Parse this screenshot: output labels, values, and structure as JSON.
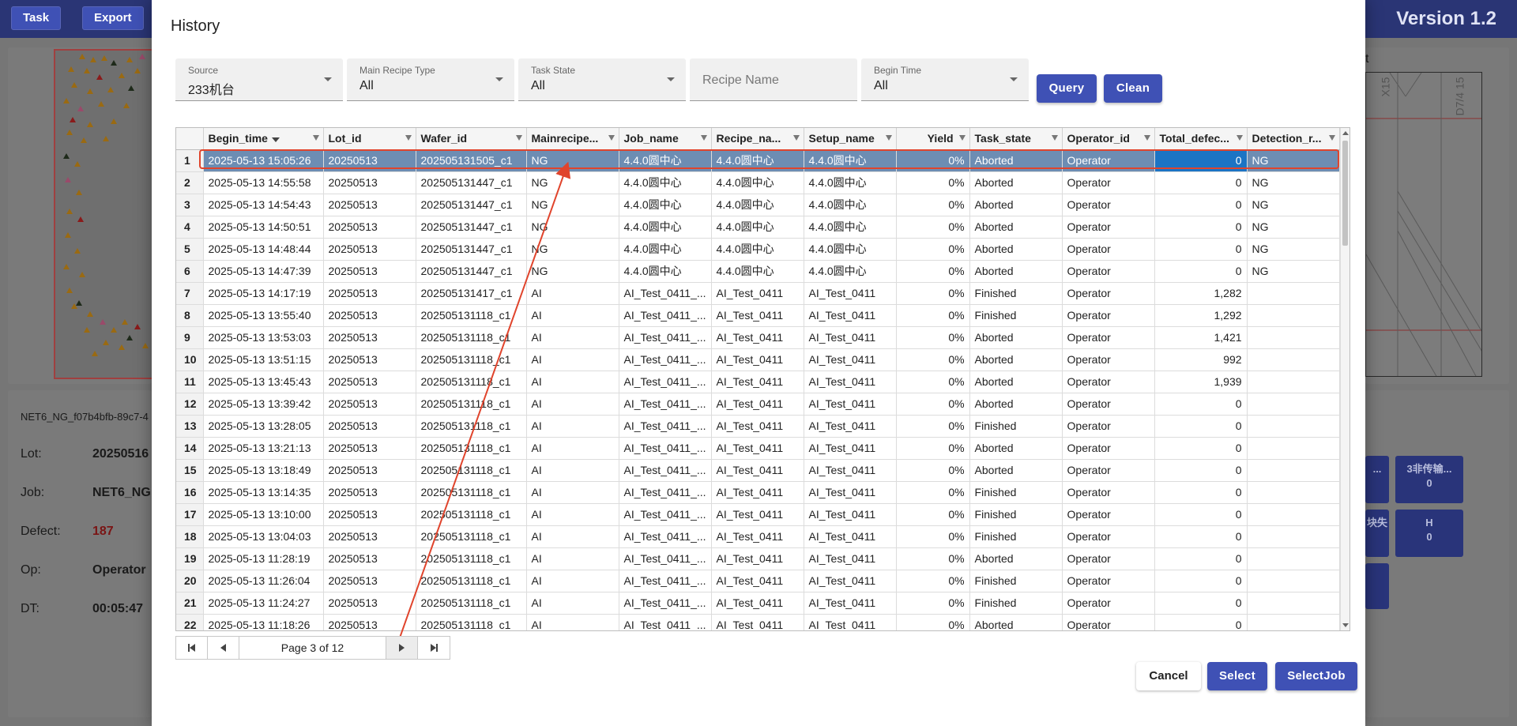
{
  "app": {
    "task_button": "Task",
    "export_button": "Export",
    "version": "Version 1.2",
    "wafer_name": "NET6_NG_f07b4bfb-89c7-4",
    "info": [
      {
        "label": "Lot:",
        "value": "20250516"
      },
      {
        "label": "Job:",
        "value": "NET6_NG"
      },
      {
        "label": "Defect:",
        "value": "187"
      },
      {
        "label": "Op:",
        "value": "Operator"
      },
      {
        "label": "DT:",
        "value": "00:05:47"
      }
    ],
    "right_header": "t",
    "right_image_labels": [
      "X15",
      "D7/4 15"
    ],
    "right_buttons": [
      {
        "line1": "3非传输...",
        "line2": "0"
      },
      {
        "line1": "H",
        "line2": "0"
      },
      {
        "line1": "...",
        "line2": ""
      },
      {
        "line1": "块失",
        "line2": ""
      }
    ],
    "colors": {
      "accent": "#3f51b5",
      "selected_row": "#6d8db3",
      "selected_cell": "#1c74c4",
      "highlight_box": "#e0442c",
      "defect_red": "#d32f2f"
    }
  },
  "dialog": {
    "title": "History",
    "filters": {
      "source": {
        "label": "Source",
        "value": "233机台"
      },
      "main_recipe_type": {
        "label": "Main Recipe Type",
        "value": "All"
      },
      "task_state": {
        "label": "Task State",
        "value": "All"
      },
      "recipe_name": {
        "placeholder": "Recipe Name"
      },
      "begin_time": {
        "label": "Begin Time",
        "value": "All"
      }
    },
    "query_button": "Query",
    "clean_button": "Clean",
    "columns": [
      "Begin_time",
      "Lot_id",
      "Wafer_id",
      "Mainrecipe...",
      "Job_name",
      "Recipe_na...",
      "Setup_name",
      "Yield",
      "Task_state",
      "Operator_id",
      "Total_defec...",
      "Detection_r..."
    ],
    "rows": [
      [
        "1",
        "2025-05-13 15:05:26",
        "20250513",
        "202505131505_c1",
        "NG",
        "4.4.0圆中心",
        "4.4.0圆中心",
        "4.4.0圆中心",
        "0%",
        "Aborted",
        "Operator",
        "0",
        "NG"
      ],
      [
        "2",
        "2025-05-13 14:55:58",
        "20250513",
        "202505131447_c1",
        "NG",
        "4.4.0圆中心",
        "4.4.0圆中心",
        "4.4.0圆中心",
        "0%",
        "Aborted",
        "Operator",
        "0",
        "NG"
      ],
      [
        "3",
        "2025-05-13 14:54:43",
        "20250513",
        "202505131447_c1",
        "NG",
        "4.4.0圆中心",
        "4.4.0圆中心",
        "4.4.0圆中心",
        "0%",
        "Aborted",
        "Operator",
        "0",
        "NG"
      ],
      [
        "4",
        "2025-05-13 14:50:51",
        "20250513",
        "202505131447_c1",
        "NG",
        "4.4.0圆中心",
        "4.4.0圆中心",
        "4.4.0圆中心",
        "0%",
        "Aborted",
        "Operator",
        "0",
        "NG"
      ],
      [
        "5",
        "2025-05-13 14:48:44",
        "20250513",
        "202505131447_c1",
        "NG",
        "4.4.0圆中心",
        "4.4.0圆中心",
        "4.4.0圆中心",
        "0%",
        "Aborted",
        "Operator",
        "0",
        "NG"
      ],
      [
        "6",
        "2025-05-13 14:47:39",
        "20250513",
        "202505131447_c1",
        "NG",
        "4.4.0圆中心",
        "4.4.0圆中心",
        "4.4.0圆中心",
        "0%",
        "Aborted",
        "Operator",
        "0",
        "NG"
      ],
      [
        "7",
        "2025-05-13 14:17:19",
        "20250513",
        "202505131417_c1",
        "AI",
        "AI_Test_0411_...",
        "AI_Test_0411",
        "AI_Test_0411",
        "0%",
        "Finished",
        "Operator",
        "1,282",
        ""
      ],
      [
        "8",
        "2025-05-13 13:55:40",
        "20250513",
        "202505131118_c1",
        "AI",
        "AI_Test_0411_...",
        "AI_Test_0411",
        "AI_Test_0411",
        "0%",
        "Finished",
        "Operator",
        "1,292",
        ""
      ],
      [
        "9",
        "2025-05-13 13:53:03",
        "20250513",
        "202505131118_c1",
        "AI",
        "AI_Test_0411_...",
        "AI_Test_0411",
        "AI_Test_0411",
        "0%",
        "Aborted",
        "Operator",
        "1,421",
        ""
      ],
      [
        "10",
        "2025-05-13 13:51:15",
        "20250513",
        "202505131118_c1",
        "AI",
        "AI_Test_0411_...",
        "AI_Test_0411",
        "AI_Test_0411",
        "0%",
        "Aborted",
        "Operator",
        "992",
        ""
      ],
      [
        "11",
        "2025-05-13 13:45:43",
        "20250513",
        "202505131118_c1",
        "AI",
        "AI_Test_0411_...",
        "AI_Test_0411",
        "AI_Test_0411",
        "0%",
        "Aborted",
        "Operator",
        "1,939",
        ""
      ],
      [
        "12",
        "2025-05-13 13:39:42",
        "20250513",
        "202505131118_c1",
        "AI",
        "AI_Test_0411_...",
        "AI_Test_0411",
        "AI_Test_0411",
        "0%",
        "Aborted",
        "Operator",
        "0",
        ""
      ],
      [
        "13",
        "2025-05-13 13:28:05",
        "20250513",
        "202505131118_c1",
        "AI",
        "AI_Test_0411_...",
        "AI_Test_0411",
        "AI_Test_0411",
        "0%",
        "Finished",
        "Operator",
        "0",
        ""
      ],
      [
        "14",
        "2025-05-13 13:21:13",
        "20250513",
        "202505131118_c1",
        "AI",
        "AI_Test_0411_...",
        "AI_Test_0411",
        "AI_Test_0411",
        "0%",
        "Aborted",
        "Operator",
        "0",
        ""
      ],
      [
        "15",
        "2025-05-13 13:18:49",
        "20250513",
        "202505131118_c1",
        "AI",
        "AI_Test_0411_...",
        "AI_Test_0411",
        "AI_Test_0411",
        "0%",
        "Aborted",
        "Operator",
        "0",
        ""
      ],
      [
        "16",
        "2025-05-13 13:14:35",
        "20250513",
        "202505131118_c1",
        "AI",
        "AI_Test_0411_...",
        "AI_Test_0411",
        "AI_Test_0411",
        "0%",
        "Finished",
        "Operator",
        "0",
        ""
      ],
      [
        "17",
        "2025-05-13 13:10:00",
        "20250513",
        "202505131118_c1",
        "AI",
        "AI_Test_0411_...",
        "AI_Test_0411",
        "AI_Test_0411",
        "0%",
        "Finished",
        "Operator",
        "0",
        ""
      ],
      [
        "18",
        "2025-05-13 13:04:03",
        "20250513",
        "202505131118_c1",
        "AI",
        "AI_Test_0411_...",
        "AI_Test_0411",
        "AI_Test_0411",
        "0%",
        "Finished",
        "Operator",
        "0",
        ""
      ],
      [
        "19",
        "2025-05-13 11:28:19",
        "20250513",
        "202505131118_c1",
        "AI",
        "AI_Test_0411_...",
        "AI_Test_0411",
        "AI_Test_0411",
        "0%",
        "Aborted",
        "Operator",
        "0",
        ""
      ],
      [
        "20",
        "2025-05-13 11:26:04",
        "20250513",
        "202505131118_c1",
        "AI",
        "AI_Test_0411_...",
        "AI_Test_0411",
        "AI_Test_0411",
        "0%",
        "Finished",
        "Operator",
        "0",
        ""
      ],
      [
        "21",
        "2025-05-13 11:24:27",
        "20250513",
        "202505131118_c1",
        "AI",
        "AI_Test_0411_...",
        "AI_Test_0411",
        "AI_Test_0411",
        "0%",
        "Finished",
        "Operator",
        "0",
        ""
      ],
      [
        "22",
        "2025-05-13 11:18:26",
        "20250513",
        "202505131118_c1",
        "AI",
        "AI_Test_0411_...",
        "AI_Test_0411",
        "AI_Test_0411",
        "0%",
        "Aborted",
        "Operator",
        "0",
        ""
      ]
    ],
    "selected_row": 1,
    "pager": {
      "text": "Page 3 of 12"
    },
    "cancel_button": "Cancel",
    "select_button": "Select",
    "selectjob_button": "SelectJob"
  }
}
